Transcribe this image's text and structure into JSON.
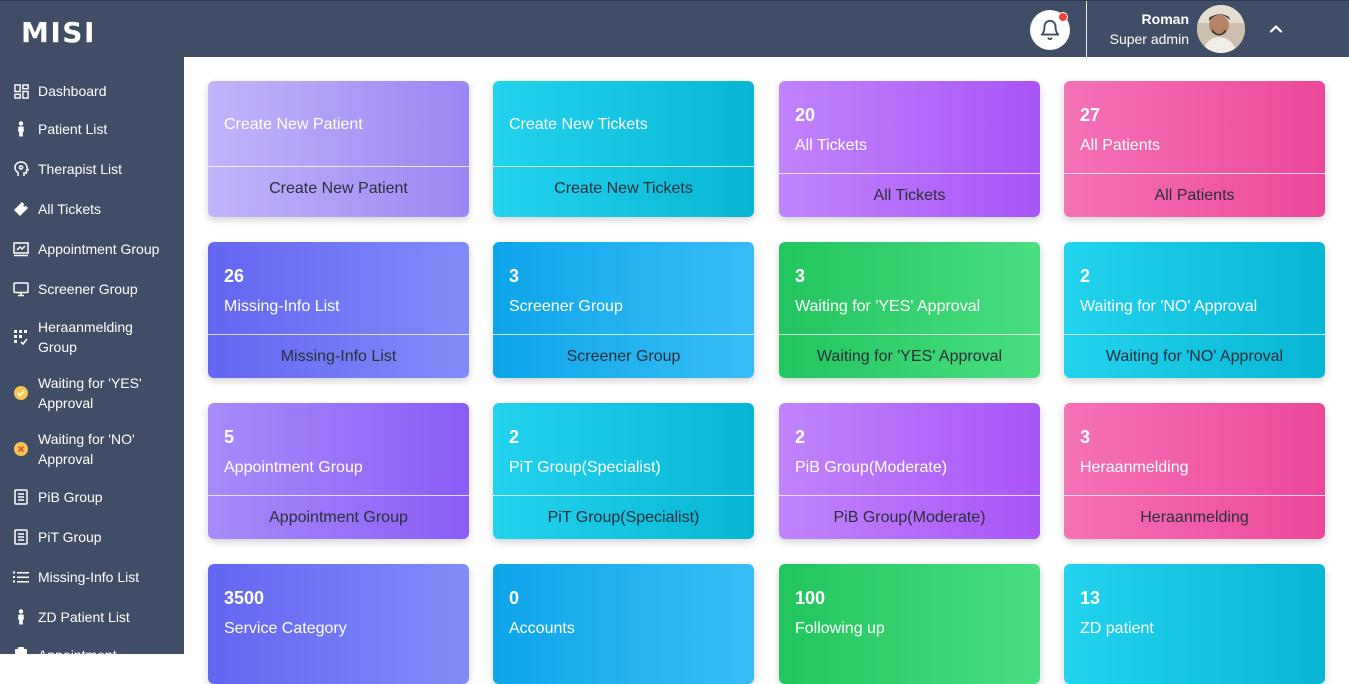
{
  "app": {
    "brand": "MISI"
  },
  "header": {
    "user_name": "Roman",
    "user_role": "Super admin"
  },
  "sidebar": {
    "items": [
      {
        "label": "Dashboard",
        "icon": "dashboard-icon"
      },
      {
        "label": "Patient List",
        "icon": "person-icon"
      },
      {
        "label": "Therapist List",
        "icon": "head-icon"
      },
      {
        "label": "All Tickets",
        "icon": "ticket-icon"
      },
      {
        "label": "Appointment Group",
        "icon": "chart-screen-icon"
      },
      {
        "label": "Screener Group",
        "icon": "monitor-icon"
      },
      {
        "label": "Heraanmelding\nGroup",
        "icon": "grid-check-icon"
      },
      {
        "label": "Waiting for 'YES'\nApproval",
        "icon": "check-circle-icon"
      },
      {
        "label": "Waiting for 'NO'\nApproval",
        "icon": "x-circle-icon"
      },
      {
        "label": "PiB Group",
        "icon": "document-icon"
      },
      {
        "label": "PiT Group",
        "icon": "document-icon"
      },
      {
        "label": "Missing-Info List",
        "icon": "list-icon"
      },
      {
        "label": "ZD Patient List",
        "icon": "person-icon"
      },
      {
        "label": "Appointment",
        "icon": "clipboard-icon"
      }
    ]
  },
  "cards": [
    {
      "count": "",
      "title": "Create New Patient",
      "footer": "Create New Patient",
      "gradient": "purple"
    },
    {
      "count": "",
      "title": "Create New Tickets",
      "footer": "Create New Tickets",
      "gradient": "cyan"
    },
    {
      "count": "20",
      "title": "All Tickets",
      "footer": "All Tickets",
      "gradient": "violet"
    },
    {
      "count": "27",
      "title": "All Patients",
      "footer": "All Patients",
      "gradient": "pink"
    },
    {
      "count": "26",
      "title": "Missing-Info List",
      "footer": "Missing-Info List",
      "gradient": "indigo"
    },
    {
      "count": "3",
      "title": "Screener Group",
      "footer": "Screener Group",
      "gradient": "sky"
    },
    {
      "count": "3",
      "title": "Waiting for 'YES' Approval",
      "footer": "Waiting for 'YES' Approval",
      "gradient": "green"
    },
    {
      "count": "2",
      "title": "Waiting for 'NO' Approval",
      "footer": "Waiting for 'NO' Approval",
      "gradient": "cyan"
    },
    {
      "count": "5",
      "title": "Appointment Group",
      "footer": "Appointment Group",
      "gradient": "lilac"
    },
    {
      "count": "2",
      "title": "PiT Group(Specialist)",
      "footer": "PiT Group(Specialist)",
      "gradient": "cyan"
    },
    {
      "count": "2",
      "title": "PiB Group(Moderate)",
      "footer": "PiB Group(Moderate)",
      "gradient": "violet"
    },
    {
      "count": "3",
      "title": "Heraanmelding",
      "footer": "Heraanmelding",
      "gradient": "pink"
    },
    {
      "count": "3500",
      "title": "Service Category",
      "footer": "",
      "gradient": "indigo"
    },
    {
      "count": "0",
      "title": "Accounts",
      "footer": "",
      "gradient": "sky"
    },
    {
      "count": "100",
      "title": "Following up",
      "footer": "",
      "gradient": "green"
    },
    {
      "count": "13",
      "title": "ZD patient",
      "footer": "",
      "gradient": "cyan"
    }
  ],
  "colors": {
    "topbar": "#3f4d67",
    "sidebar": "#3f4d67",
    "notification_dot": "#f44236"
  }
}
